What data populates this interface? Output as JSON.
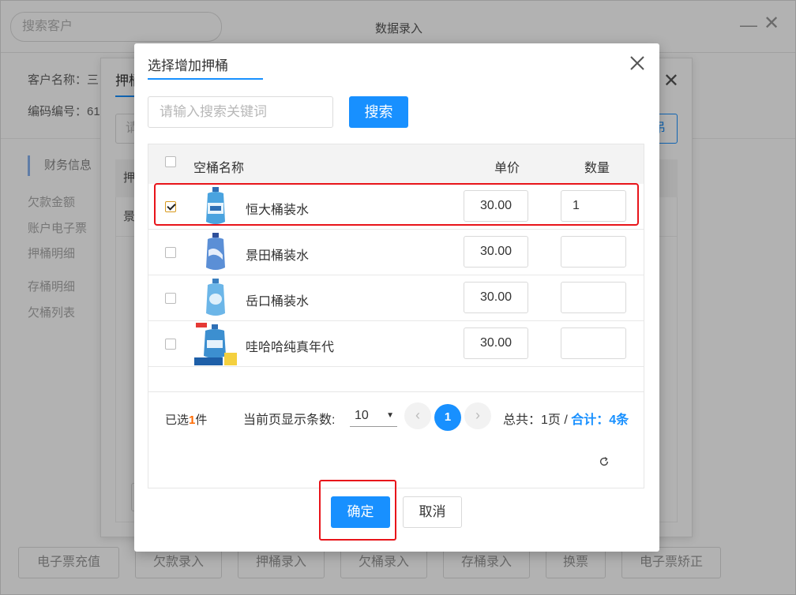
{
  "base": {
    "search_placeholder": "搜索客户",
    "title": "数据录入",
    "customer_label": "客户名称：三",
    "code_label": "编码编号：61",
    "sidenav": {
      "title": "财务信息",
      "items": [
        "欠款金额",
        "账户电子票",
        "押桶明细",
        "存桶明细",
        "欠桶列表"
      ]
    },
    "bottom_buttons": [
      "电子票充值",
      "欠款录入",
      "押桶录入",
      "欠桶录入",
      "存桶录入",
      "换票",
      "电子票矫正"
    ]
  },
  "middle_dialog": {
    "tab": "押桶",
    "input_placeholder": "请",
    "button_label": "吊",
    "table_header": "押",
    "row_text": "景"
  },
  "modal": {
    "title": "选择增加押桶",
    "search_placeholder": "请输入搜索关键词",
    "search_button": "搜索",
    "columns": {
      "name": "空桶名称",
      "price": "单价",
      "qty": "数量"
    },
    "rows": [
      {
        "name": "恒大桶装水",
        "price": "30.00",
        "qty": "1",
        "checked": true,
        "bottle_color": "#4aa3df"
      },
      {
        "name": "景田桶装水",
        "price": "30.00",
        "qty": "",
        "checked": false,
        "bottle_color": "#5b8fd6"
      },
      {
        "name": "岳口桶装水",
        "price": "30.00",
        "qty": "",
        "checked": false,
        "bottle_color": "#6cb6e8"
      },
      {
        "name": "哇哈哈纯真年代",
        "price": "30.00",
        "qty": "",
        "checked": false,
        "bottle_color": "#3c8fd0"
      }
    ],
    "footer": {
      "selected_prefix": "已选",
      "selected_count": "1",
      "selected_suffix": "件",
      "page_size_label": "当前页显示条数:",
      "page_size": "10",
      "prev": "‹",
      "current_page": "1",
      "next": "›",
      "total_text": "总共：1页 /",
      "sum_text": "合计：4条"
    },
    "ok_button": "确定",
    "cancel_button": "取消"
  },
  "colors": {
    "primary": "#1890ff",
    "highlight": "#e8141a",
    "selected_count": "#ff6a00"
  }
}
